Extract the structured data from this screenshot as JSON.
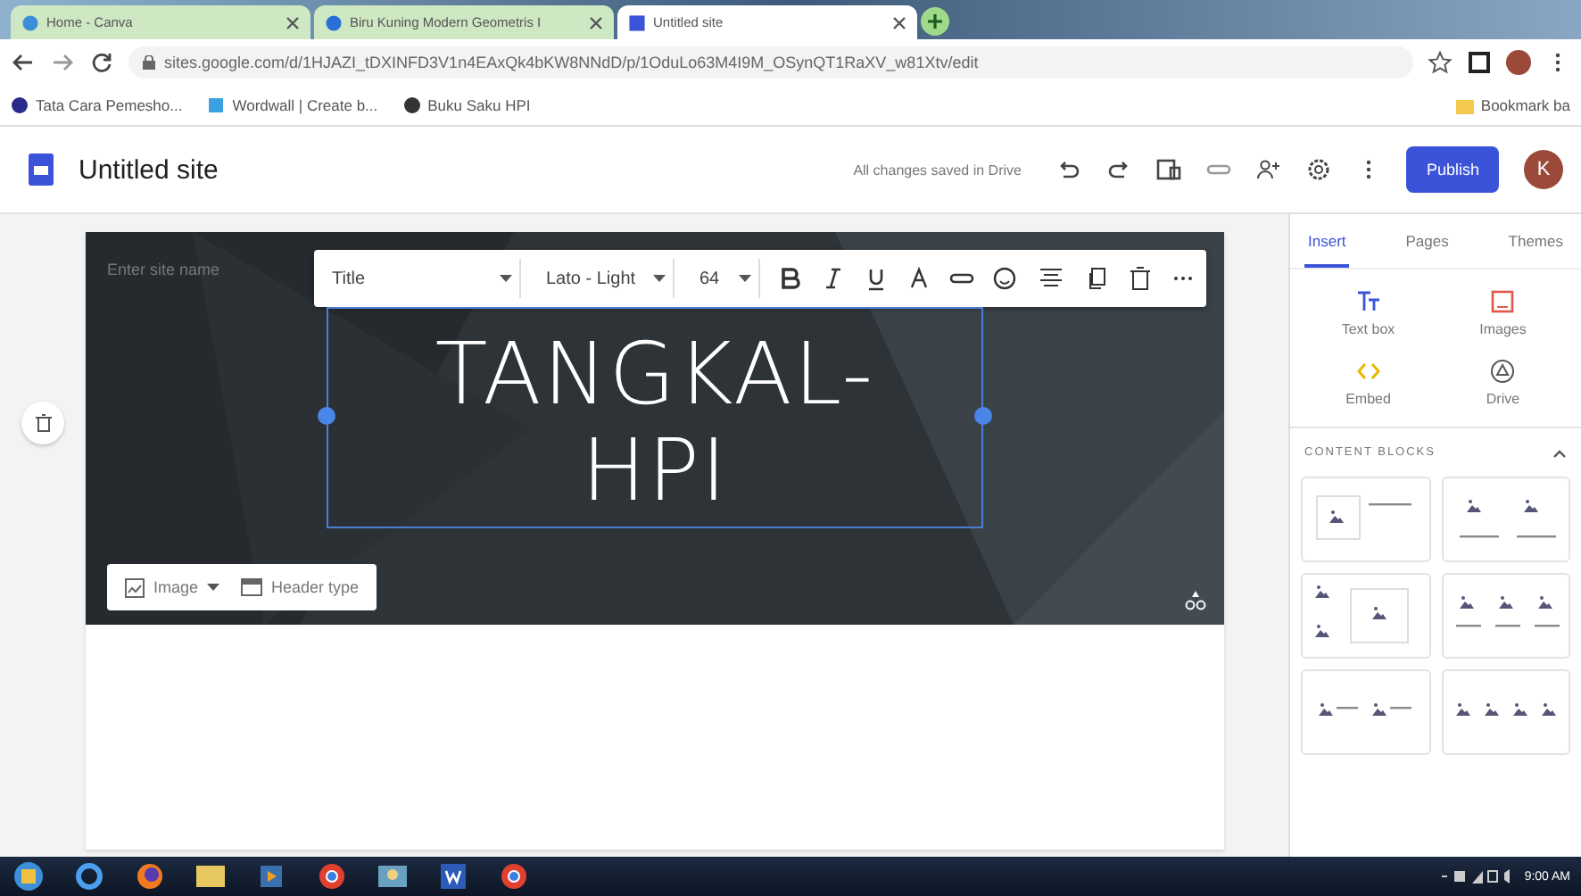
{
  "browser": {
    "tabs": [
      {
        "title": "Home - Canva",
        "selected": false
      },
      {
        "title": "Biru Kuning Modern Geometris I",
        "selected": false
      },
      {
        "title": "Untitled site",
        "selected": true
      }
    ],
    "url": "sites.google.com/d/1HJAZI_tDXINFD3V1n4EAxQk4bKW8NNdD/p/1OduLo63M4I9M_OSynQT1RaXV_w81Xtv/edit",
    "bookmarks": [
      "Tata Cara Pemesho...",
      "Wordwall | Create b...",
      "Buku Saku HPI"
    ],
    "bookmark_folder": "Bookmark ba"
  },
  "app": {
    "title": "Untitled site",
    "save_status": "All changes saved in Drive",
    "publish": "Publish",
    "avatar": "K"
  },
  "editor": {
    "site_name_placeholder": "Enter site name",
    "text_toolbar": {
      "style": "Title",
      "font": "Lato - Light",
      "size": "64"
    },
    "title_lines": [
      "TANGKAL-",
      "HPI"
    ],
    "header_buttons": [
      "Image",
      "Header type"
    ]
  },
  "panel": {
    "tabs": [
      {
        "label": "Insert",
        "selected": true
      },
      {
        "label": "Pages",
        "selected": false
      },
      {
        "label": "Themes",
        "selected": false
      }
    ],
    "items": [
      {
        "kind": "textbox",
        "label": "Text box"
      },
      {
        "kind": "images",
        "label": "Images"
      },
      {
        "kind": "embed",
        "label": "Embed"
      },
      {
        "kind": "drive",
        "label": "Drive"
      }
    ],
    "content_blocks_title": "CONTENT BLOCKS",
    "content_blocks": [
      {
        "kind": "image-text"
      },
      {
        "kind": "two-col"
      },
      {
        "kind": "mixed"
      },
      {
        "kind": "three-col"
      },
      {
        "kind": "two-row"
      },
      {
        "kind": "four-col"
      }
    ]
  },
  "taskbar": {
    "time": "9:00 AM"
  }
}
